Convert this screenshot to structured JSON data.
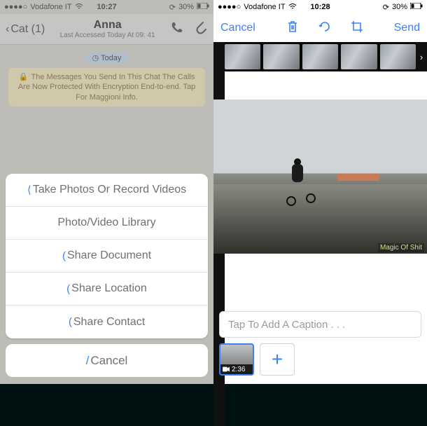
{
  "colors": {
    "accent": "#3b82f6"
  },
  "left": {
    "status": {
      "carrier": "Vodafone IT",
      "time": "10:27",
      "battery": "30%"
    },
    "nav": {
      "back_label": "Cat (1)",
      "title": "Anna",
      "subtitle": "Last Accessed Today At 09: 41"
    },
    "day_label": "Today",
    "system_message": "The Messages You Send In This Chat The Calls Are Now Protected With Encryption End-to-end. Tap For Maggioni Info.",
    "sheet": {
      "items": [
        "Take Photos Or Record Videos",
        "Photo/Video Library",
        "Share Document",
        "Share Location",
        "Share Contact"
      ],
      "cancel": "Cancel"
    }
  },
  "right": {
    "status": {
      "carrier": "Vodafone IT",
      "time": "10:28",
      "battery": "30%"
    },
    "toolbar": {
      "cancel": "Cancel",
      "send": "Send",
      "icons": [
        "trash-icon",
        "rotate-icon",
        "crop-icon"
      ]
    },
    "watermark": "Magic Of Shit",
    "caption_placeholder": "Tap To Add A Caption . . .",
    "video_duration": "2:36"
  }
}
